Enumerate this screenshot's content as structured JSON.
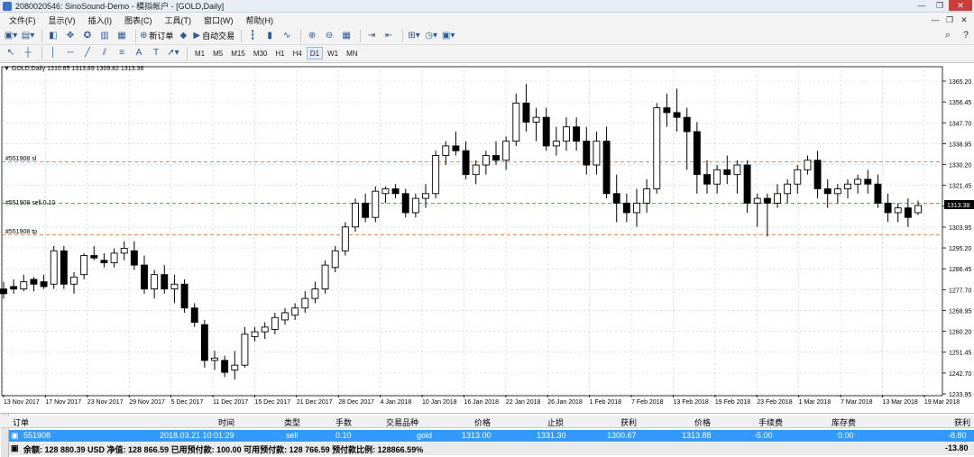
{
  "window": {
    "title": "2080020546: SinoSound-Demo - 模拟帐户 - [GOLD,Daily]",
    "controls": [
      "—",
      "❐",
      "✕"
    ]
  },
  "menu": [
    "文件(F)",
    "显示(V)",
    "插入(I)",
    "图表(C)",
    "工具(T)",
    "窗口(W)",
    "帮助(H)"
  ],
  "menu_right": [
    "—",
    "❐",
    "✕"
  ],
  "toolbar": {
    "new_order": "新订单",
    "auto_trade": "自动交易"
  },
  "timeframes": [
    "M1",
    "M5",
    "M15",
    "M30",
    "H1",
    "H4",
    "D1",
    "W1",
    "MN"
  ],
  "active_timeframe": "D1",
  "chart": {
    "symbol_info": "GOLD,Daily  1310.85 1313.89 1309.82 1313.38",
    "current_price": "1313.38",
    "sl_label": "#551908 sl",
    "order_label": "#551908 sell 0.10",
    "tp_label": "#551908 tp",
    "colors": {
      "sl": "#e08a4a",
      "tp": "#e08a4a",
      "order": "#4aa84a",
      "candle": "#000000"
    }
  },
  "chart_data": {
    "type": "candlestick",
    "symbol": "GOLD",
    "timeframe": "Daily",
    "y_ticks": [
      1365.2,
      1356.45,
      1347.7,
      1338.95,
      1330.2,
      1321.45,
      1312.7,
      1303.95,
      1295.2,
      1286.45,
      1277.7,
      1268.95,
      1260.2,
      1251.45,
      1242.7,
      1233.95
    ],
    "ylim": [
      1233.95,
      1370
    ],
    "x_labels": [
      "13 Nov 2017",
      "17 Nov 2017",
      "23 Nov 2017",
      "29 Nov 2017",
      "5 Dec 2017",
      "11 Dec 2017",
      "15 Dec 2017",
      "21 Dec 2017",
      "28 Dec 2017",
      "4 Jan 2018",
      "10 Jan 2018",
      "16 Jan 2018",
      "22 Jan 2018",
      "26 Jan 2018",
      "1 Feb 2018",
      "7 Feb 2018",
      "13 Feb 2018",
      "19 Feb 2018",
      "23 Feb 2018",
      "1 Mar 2018",
      "7 Mar 2018",
      "13 Mar 2018",
      "19 Mar 2018"
    ],
    "levels": {
      "sl": 1331.3,
      "order": 1313.88,
      "tp": 1300.67
    },
    "candles": [
      [
        1278,
        1281,
        1274,
        1276
      ],
      [
        1279,
        1282,
        1276,
        1278
      ],
      [
        1278,
        1284,
        1277,
        1281
      ],
      [
        1282,
        1283,
        1277,
        1280
      ],
      [
        1281,
        1284,
        1278,
        1279
      ],
      [
        1280,
        1296,
        1278,
        1294
      ],
      [
        1294,
        1296,
        1278,
        1280
      ],
      [
        1280,
        1285,
        1276,
        1283
      ],
      [
        1284,
        1293,
        1282,
        1292
      ],
      [
        1292,
        1296,
        1290,
        1291
      ],
      [
        1290,
        1293,
        1287,
        1289
      ],
      [
        1289,
        1295,
        1287,
        1293
      ],
      [
        1293,
        1298,
        1290,
        1295
      ],
      [
        1294,
        1298,
        1286,
        1288
      ],
      [
        1288,
        1292,
        1276,
        1278
      ],
      [
        1278,
        1286,
        1274,
        1284
      ],
      [
        1284,
        1288,
        1276,
        1278
      ],
      [
        1278,
        1284,
        1272,
        1280
      ],
      [
        1280,
        1282,
        1268,
        1270
      ],
      [
        1270,
        1272,
        1262,
        1264
      ],
      [
        1263,
        1265,
        1245,
        1248
      ],
      [
        1248,
        1252,
        1244,
        1249
      ],
      [
        1248,
        1250,
        1241,
        1243
      ],
      [
        1244,
        1252,
        1240,
        1246
      ],
      [
        1246,
        1262,
        1245,
        1259
      ],
      [
        1258,
        1262,
        1256,
        1260
      ],
      [
        1260,
        1264,
        1257,
        1262
      ],
      [
        1261,
        1268,
        1259,
        1266
      ],
      [
        1265,
        1270,
        1263,
        1268
      ],
      [
        1267,
        1272,
        1265,
        1270
      ],
      [
        1270,
        1277,
        1268,
        1274
      ],
      [
        1274,
        1281,
        1272,
        1278
      ],
      [
        1278,
        1290,
        1276,
        1288
      ],
      [
        1287,
        1296,
        1285,
        1294
      ],
      [
        1294,
        1306,
        1292,
        1304
      ],
      [
        1304,
        1316,
        1302,
        1314
      ],
      [
        1314,
        1318,
        1306,
        1308
      ],
      [
        1308,
        1321,
        1306,
        1319
      ],
      [
        1318,
        1321,
        1314,
        1320
      ],
      [
        1320,
        1322,
        1316,
        1318
      ],
      [
        1318,
        1320,
        1308,
        1310
      ],
      [
        1310,
        1318,
        1308,
        1316
      ],
      [
        1316,
        1322,
        1312,
        1318
      ],
      [
        1318,
        1336,
        1316,
        1334
      ],
      [
        1334,
        1340,
        1330,
        1338
      ],
      [
        1338,
        1344,
        1334,
        1336
      ],
      [
        1336,
        1340,
        1324,
        1326
      ],
      [
        1326,
        1332,
        1322,
        1330
      ],
      [
        1330,
        1336,
        1326,
        1334
      ],
      [
        1334,
        1340,
        1330,
        1332
      ],
      [
        1332,
        1342,
        1328,
        1340
      ],
      [
        1340,
        1360,
        1338,
        1356
      ],
      [
        1356,
        1364,
        1344,
        1348
      ],
      [
        1348,
        1354,
        1340,
        1350
      ],
      [
        1350,
        1354,
        1336,
        1338
      ],
      [
        1338,
        1346,
        1334,
        1340
      ],
      [
        1340,
        1350,
        1336,
        1346
      ],
      [
        1346,
        1350,
        1336,
        1340
      ],
      [
        1340,
        1346,
        1326,
        1330
      ],
      [
        1330,
        1344,
        1326,
        1340
      ],
      [
        1340,
        1346,
        1316,
        1318
      ],
      [
        1318,
        1326,
        1306,
        1314
      ],
      [
        1314,
        1318,
        1306,
        1310
      ],
      [
        1310,
        1320,
        1304,
        1314
      ],
      [
        1314,
        1324,
        1310,
        1320
      ],
      [
        1320,
        1356,
        1318,
        1354
      ],
      [
        1354,
        1360,
        1346,
        1352
      ],
      [
        1352,
        1362,
        1344,
        1350
      ],
      [
        1350,
        1354,
        1328,
        1344
      ],
      [
        1344,
        1348,
        1318,
        1326
      ],
      [
        1326,
        1332,
        1318,
        1322
      ],
      [
        1322,
        1330,
        1318,
        1328
      ],
      [
        1328,
        1334,
        1322,
        1326
      ],
      [
        1326,
        1332,
        1318,
        1330
      ],
      [
        1330,
        1332,
        1310,
        1314
      ],
      [
        1314,
        1318,
        1304,
        1316
      ],
      [
        1316,
        1318,
        1300,
        1314
      ],
      [
        1314,
        1322,
        1312,
        1318
      ],
      [
        1318,
        1324,
        1314,
        1322
      ],
      [
        1322,
        1330,
        1318,
        1328
      ],
      [
        1328,
        1334,
        1326,
        1332
      ],
      [
        1332,
        1336,
        1316,
        1320
      ],
      [
        1320,
        1324,
        1312,
        1318
      ],
      [
        1318,
        1322,
        1314,
        1320
      ],
      [
        1320,
        1324,
        1316,
        1322
      ],
      [
        1322,
        1326,
        1318,
        1324
      ],
      [
        1324,
        1328,
        1318,
        1322
      ],
      [
        1322,
        1326,
        1312,
        1314
      ],
      [
        1314,
        1318,
        1306,
        1310
      ],
      [
        1310,
        1314,
        1306,
        1312
      ],
      [
        1312,
        1316,
        1304,
        1308
      ],
      [
        1310,
        1315,
        1309,
        1313
      ]
    ]
  },
  "terminal": {
    "headers": [
      "订单",
      "时间",
      "类型",
      "手数",
      "交易品种",
      "价格",
      "止损",
      "获利",
      "价格",
      "手续费",
      "库存费",
      "获利"
    ],
    "row": [
      "551908",
      "2018.03.21 10:01:29",
      "sell",
      "0.10",
      "gold",
      "1313.00",
      "1331.30",
      "1300.67",
      "1313.88",
      "-5.00",
      "0.00",
      "-8.80"
    ],
    "balance": "余额: 128 880.39 USD  净值: 128 866.59  已用预付款: 100.00  可用预付款: 128 766.59  预付款比例: 128866.59%",
    "total": "-13.80"
  }
}
